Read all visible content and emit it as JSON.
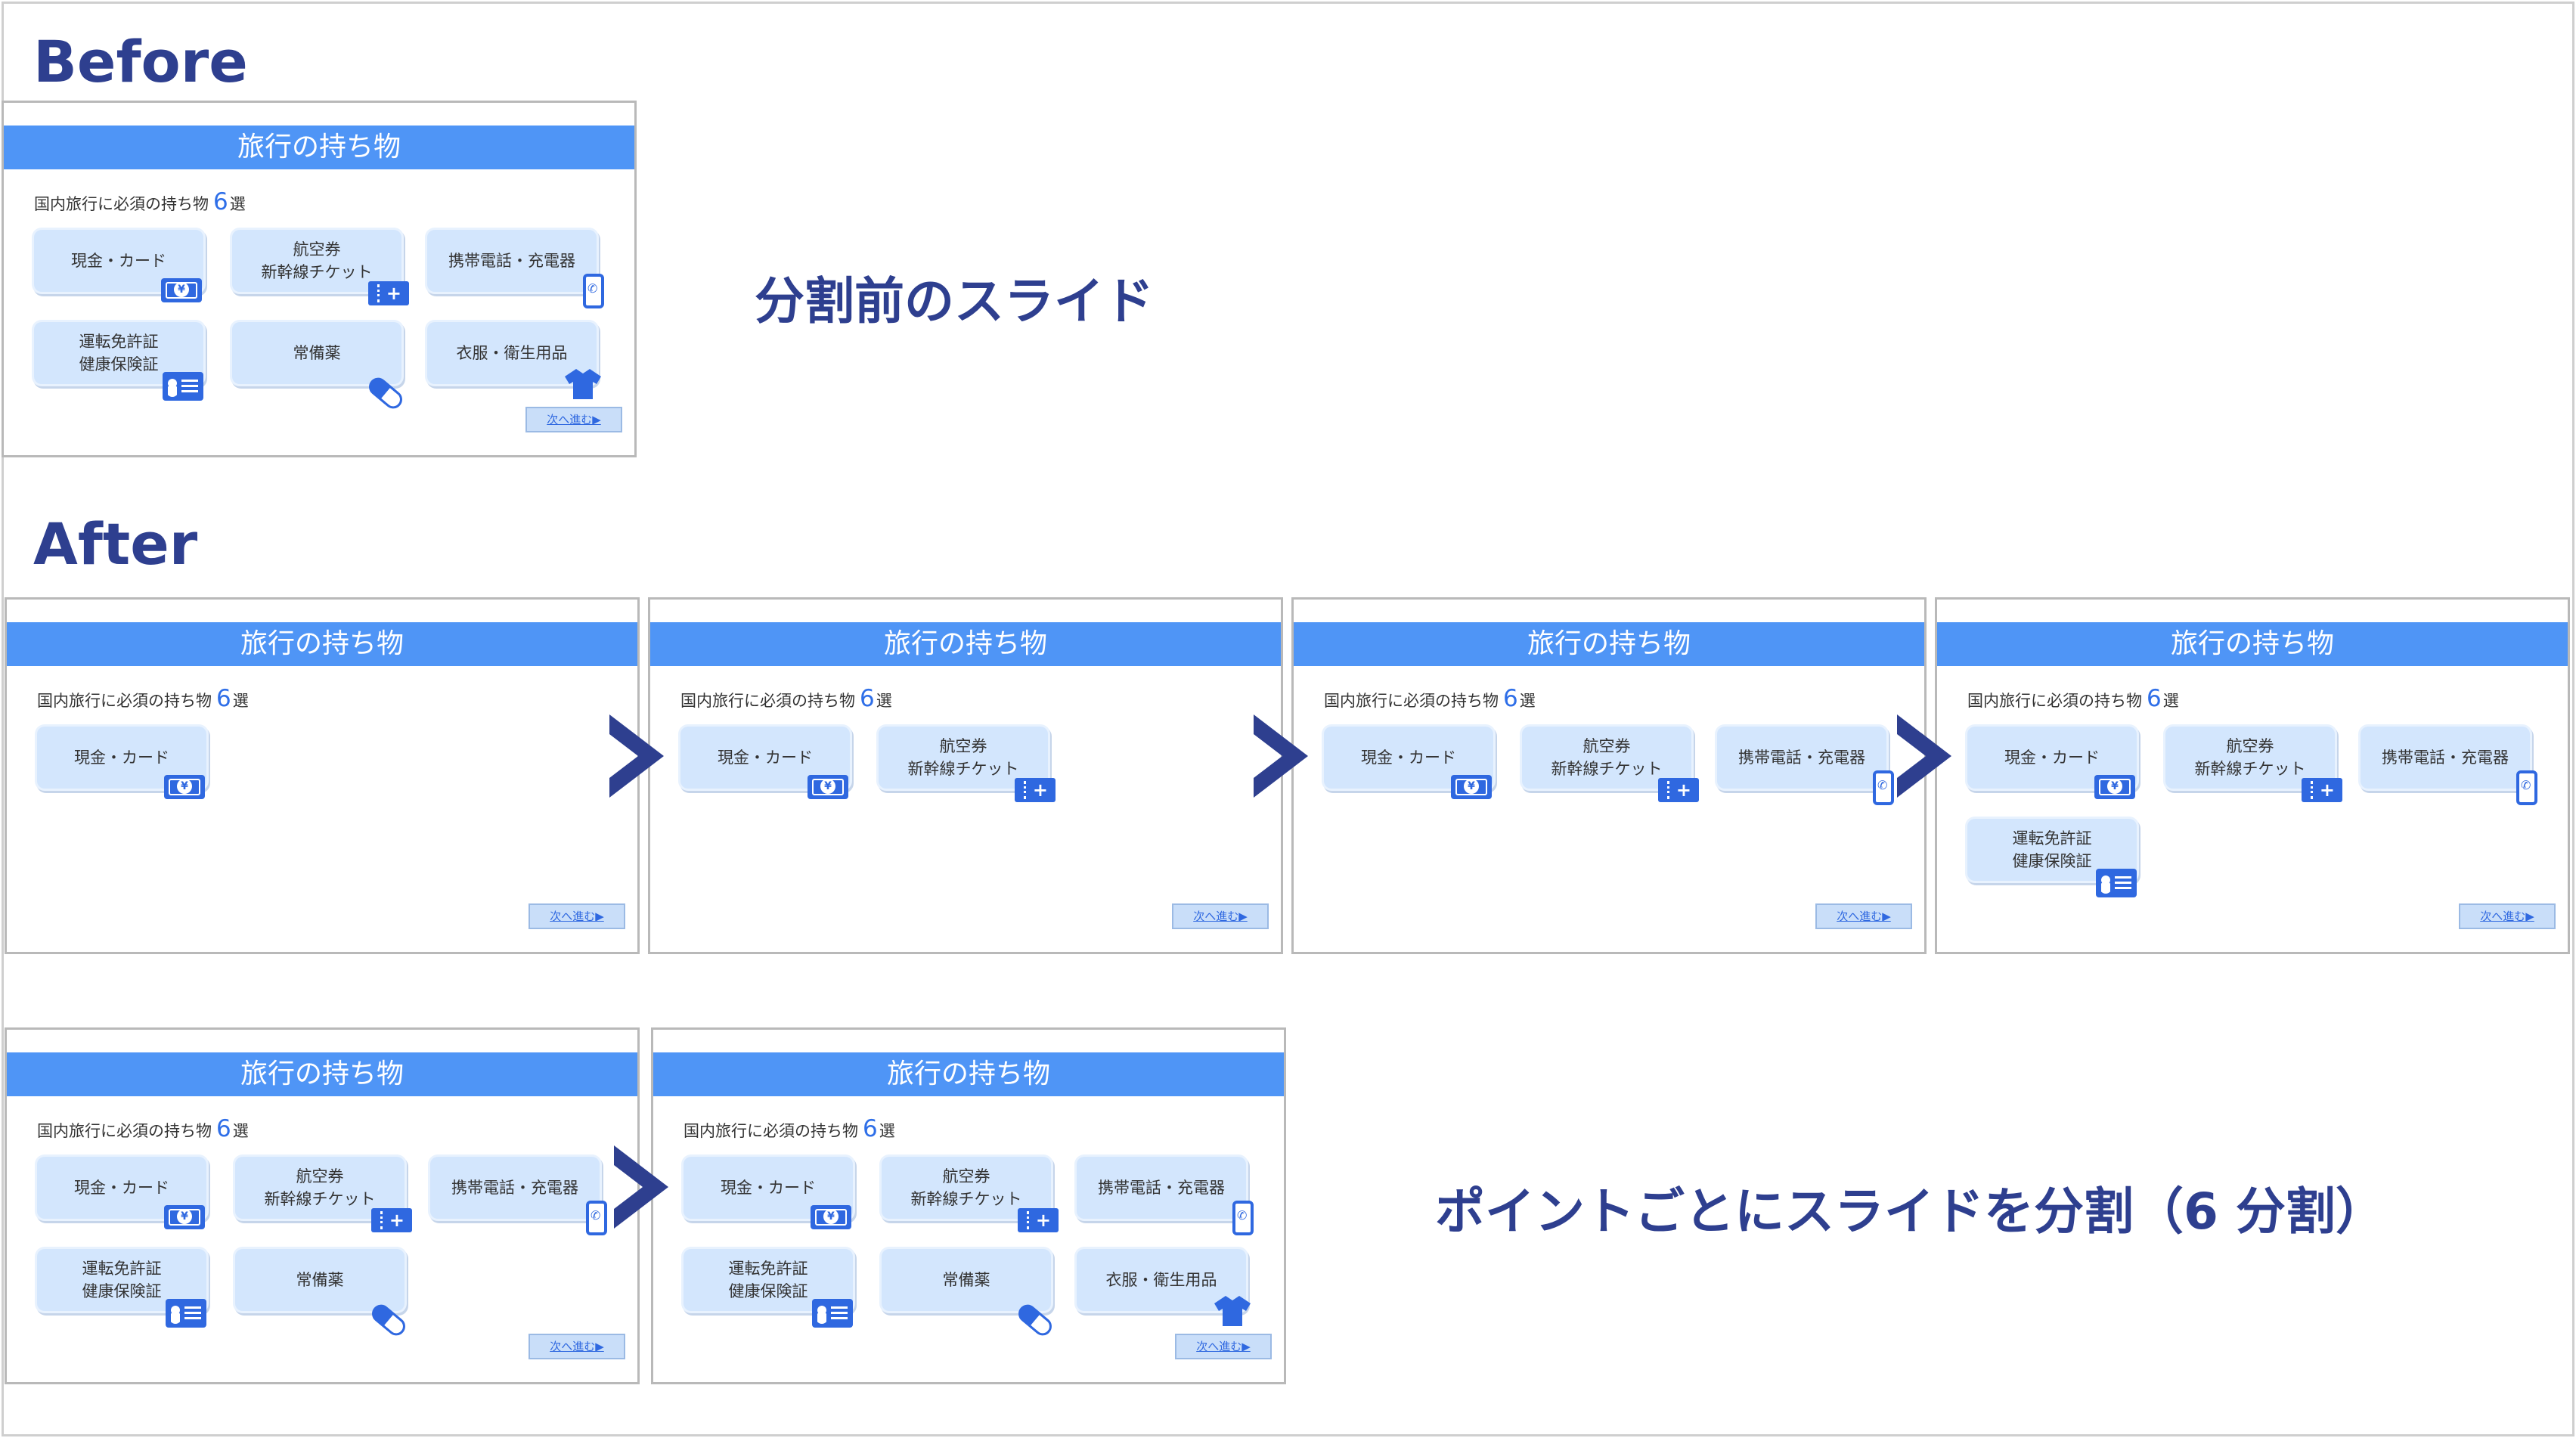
{
  "headings": {
    "before": "Before",
    "after": "After"
  },
  "captions": {
    "before": "分割前のスライド",
    "after": "ポイントごとにスライドを分割（6 分割）"
  },
  "slide": {
    "title": "旅行の持ち物",
    "subtitle_prefix": "国内旅行に必須の持ち物",
    "subtitle_count": "6",
    "subtitle_suffix": "選",
    "next_button": "次へ進む▶",
    "items": [
      {
        "label": "現金・カード",
        "icon": "money-icon"
      },
      {
        "label": "航空券\n新幹線チケット",
        "icon": "ticket-icon"
      },
      {
        "label": "携帯電話・充電器",
        "icon": "phone-icon"
      },
      {
        "label": "運転免許証\n健康保険証",
        "icon": "id-card-icon"
      },
      {
        "label": "常備薬",
        "icon": "pill-icon"
      },
      {
        "label": "衣服・衛生用品",
        "icon": "shirt-icon"
      }
    ]
  },
  "colors": {
    "heading": "#2e3f8f",
    "title_bar": "#4f95f6",
    "card": "#d3e6fd",
    "icon": "#2f68e0",
    "arrow": "#2e3f8f"
  }
}
